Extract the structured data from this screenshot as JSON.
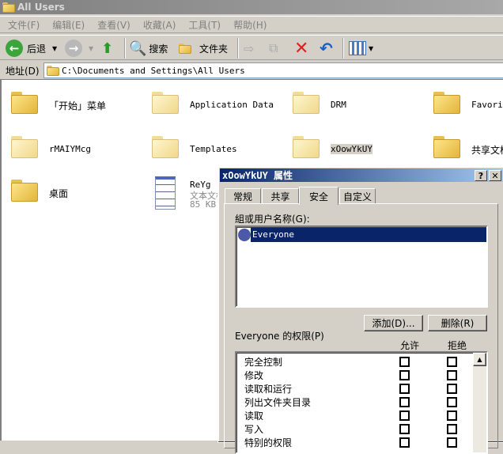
{
  "window": {
    "title": "All Users"
  },
  "menu": [
    "文件(F)",
    "编辑(E)",
    "查看(V)",
    "收藏(A)",
    "工具(T)",
    "帮助(H)"
  ],
  "toolbar": {
    "back": "后退",
    "search": "搜索",
    "folders": "文件夹"
  },
  "address": {
    "label": "地址(D)",
    "value": "C:\\Documents and Settings\\All Users"
  },
  "items": [
    {
      "name": "「开始」菜单"
    },
    {
      "name": "Application Data"
    },
    {
      "name": "DRM"
    },
    {
      "name": "Favorites"
    },
    {
      "name": "rMAIYMcg"
    },
    {
      "name": "Templates"
    },
    {
      "name": "xOowYkUY"
    },
    {
      "name": "共享文档"
    },
    {
      "name": "桌面"
    },
    {
      "name": "ReYg",
      "type": "文本文档",
      "size": "85 KB"
    }
  ],
  "dialog": {
    "title": "xOowYkUY 属性",
    "help": "?",
    "close": "✕",
    "tabs": [
      "常规",
      "共享",
      "安全",
      "自定义"
    ],
    "active_tab": "安全",
    "group_label": "組或用户名称(G):",
    "users": [
      "Everyone"
    ],
    "add_button": "添加(D)...",
    "remove_button": "删除(R)",
    "perm_label": "Everyone 的权限(P)",
    "allow": "允许",
    "deny": "拒绝",
    "permissions": [
      "完全控制",
      "修改",
      "读取和运行",
      "列出文件夹目录",
      "读取",
      "写入",
      "特别的权限"
    ]
  }
}
